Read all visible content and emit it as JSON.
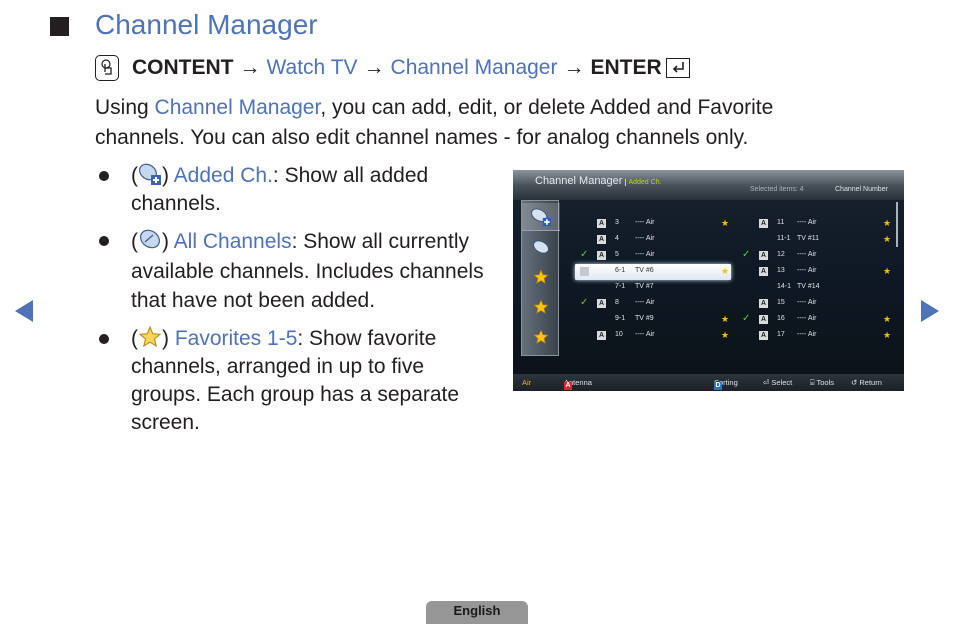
{
  "section": {
    "title": "Channel Manager"
  },
  "menu_path": {
    "content": "CONTENT",
    "arrow": "→",
    "watch_tv": "Watch TV",
    "channel_manager": "Channel Manager",
    "enter": "ENTER"
  },
  "intro": {
    "prefix": "Using ",
    "highlight": "Channel Manager",
    "suffix": ", you can add, edit, or delete Added and Favorite channels. You can also edit channel names - for analog channels only."
  },
  "bullets": [
    {
      "icon": "satellite-dish-plus-icon",
      "label": "Added Ch.",
      "text": ": Show all added channels."
    },
    {
      "icon": "satellite-dish-icon",
      "label": "All Channels",
      "text": ": Show all currently available channels. Includes channels that have not been added."
    },
    {
      "icon": "star-icon",
      "label": "Favorites 1-5",
      "text": ": Show favorite channels, arranged in up to five groups. Each group has a separate screen."
    }
  ],
  "tv_screen": {
    "title": "Channel Manager",
    "subtitle": "Added Ch.",
    "selected_items": "Selected items: 4",
    "sort_label": "Channel Number",
    "columns": [
      [
        {
          "checked": false,
          "antenna": true,
          "num": "3",
          "name": "---- Air",
          "fav": true
        },
        {
          "checked": false,
          "antenna": true,
          "num": "4",
          "name": "---- Air",
          "fav": false
        },
        {
          "checked": true,
          "antenna": true,
          "num": "5",
          "name": "---- Air",
          "fav": false
        },
        {
          "checked": false,
          "antenna": false,
          "num": "6-1",
          "name": "TV #6",
          "fav": true,
          "highlight": true
        },
        {
          "checked": false,
          "antenna": false,
          "num": "7-1",
          "name": "TV #7",
          "fav": false
        },
        {
          "checked": true,
          "antenna": true,
          "num": "8",
          "name": "---- Air",
          "fav": false
        },
        {
          "checked": false,
          "antenna": false,
          "num": "9-1",
          "name": "TV #9",
          "fav": true
        },
        {
          "checked": false,
          "antenna": true,
          "num": "10",
          "name": "---- Air",
          "fav": true
        }
      ],
      [
        {
          "checked": false,
          "antenna": true,
          "num": "11",
          "name": "---- Air",
          "fav": true
        },
        {
          "checked": false,
          "antenna": false,
          "num": "11-1",
          "name": "TV #11",
          "fav": true
        },
        {
          "checked": true,
          "antenna": true,
          "num": "12",
          "name": "---- Air",
          "fav": false
        },
        {
          "checked": false,
          "antenna": true,
          "num": "13",
          "name": "---- Air",
          "fav": true
        },
        {
          "checked": false,
          "antenna": false,
          "num": "14-1",
          "name": "TV #14",
          "fav": false
        },
        {
          "checked": false,
          "antenna": true,
          "num": "15",
          "name": "---- Air",
          "fav": false
        },
        {
          "checked": true,
          "antenna": true,
          "num": "16",
          "name": "---- Air",
          "fav": true
        },
        {
          "checked": false,
          "antenna": true,
          "num": "17",
          "name": "---- Air",
          "fav": true
        }
      ]
    ],
    "footer": {
      "source": "Air",
      "antenna_key": "A",
      "antenna_label": "Antenna",
      "sorting_key": "D",
      "sorting_label": "Sorting",
      "select_label": "Select",
      "tools_label": "Tools",
      "return_label": "Return"
    },
    "colors": {
      "red_key": "#d7262c",
      "blue_key": "#2a6fd6"
    }
  },
  "footer": {
    "language": "English"
  },
  "colors": {
    "accent": "#4f73b6",
    "text": "#231f20"
  }
}
